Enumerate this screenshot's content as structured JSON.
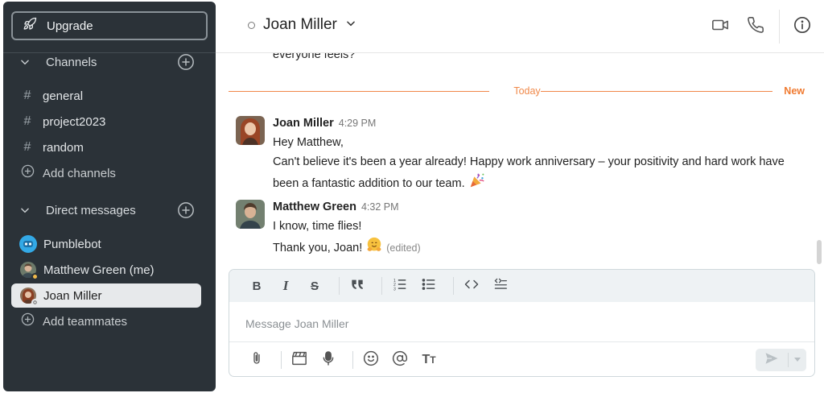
{
  "sidebar": {
    "upgrade_label": "Upgrade",
    "channels_header": "Channels",
    "channels": [
      {
        "label": "general"
      },
      {
        "label": "project2023"
      },
      {
        "label": "random"
      }
    ],
    "add_channels_label": "Add channels",
    "dm_header": "Direct messages",
    "dms": [
      {
        "label": "Pumblebot"
      },
      {
        "label": "Matthew Green (me)"
      },
      {
        "label": "Joan Miller"
      }
    ],
    "add_teammates_label": "Add teammates"
  },
  "header": {
    "contact_name": "Joan Miller"
  },
  "messages": {
    "previous_tail": "everyone feels?",
    "today_label": "Today",
    "new_label": "New",
    "items": [
      {
        "author": "Joan Miller",
        "time": "4:29 PM",
        "lines": [
          "Hey Matthew,",
          "Can't believe it's been a year already! Happy work anniversary – your positivity and hard work have",
          "been a fantastic addition to our team."
        ]
      },
      {
        "author": "Matthew Green",
        "time": "4:32 PM",
        "lines": [
          "I know, time flies!",
          "Thank you, Joan!"
        ],
        "edited": "(edited)"
      }
    ]
  },
  "composer": {
    "placeholder": "Message Joan Miller"
  },
  "colors": {
    "sidebar_bg": "#2b3238",
    "accent_orange": "#f07a30",
    "active_item_bg": "#e7e9eb"
  },
  "icons": {
    "upgrade": "rocket-icon",
    "video": "video-camera-icon",
    "call": "phone-icon",
    "info": "info-icon"
  }
}
